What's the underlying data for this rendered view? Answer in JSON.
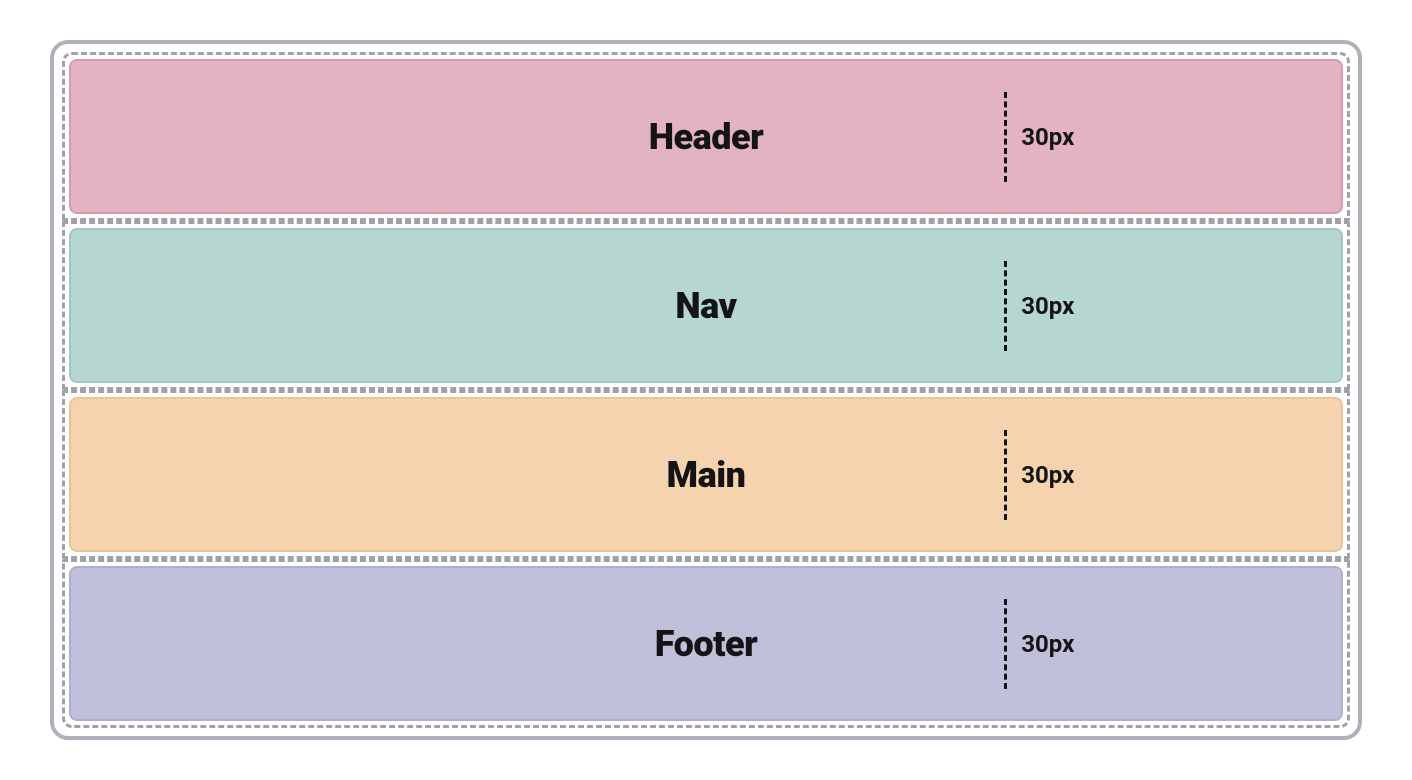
{
  "regions": [
    {
      "label": "Header",
      "measure": "30px"
    },
    {
      "label": "Nav",
      "measure": "30px"
    },
    {
      "label": "Main",
      "measure": "30px"
    },
    {
      "label": "Footer",
      "measure": "30px"
    }
  ]
}
